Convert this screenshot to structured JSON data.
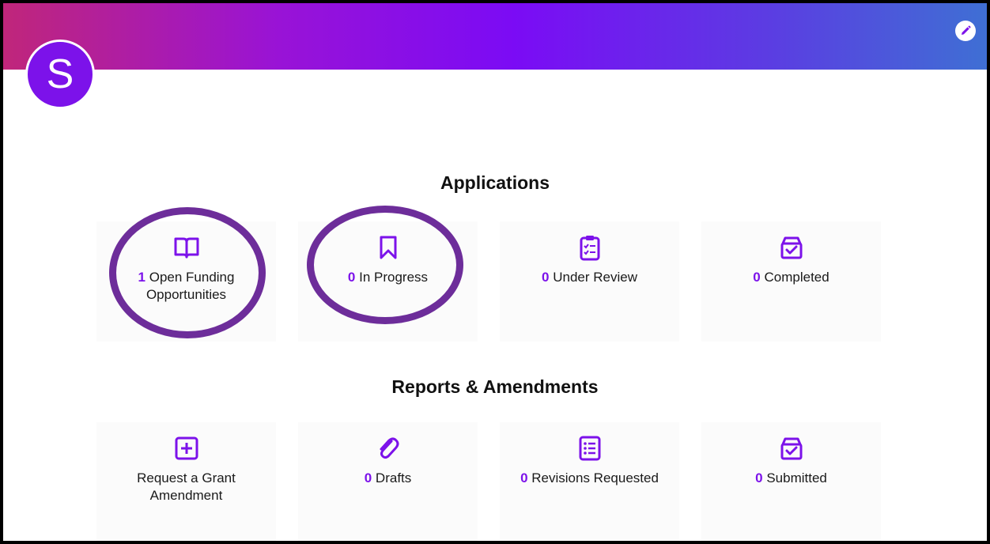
{
  "header": {
    "avatar_letter": "S",
    "edit_icon": "pencil-icon"
  },
  "applications": {
    "title": "Applications",
    "cards": [
      {
        "icon": "book-open-icon",
        "count": "1",
        "text": "Open Funding Opportunities"
      },
      {
        "icon": "bookmark-icon",
        "count": "0",
        "text": "In Progress"
      },
      {
        "icon": "clipboard-check-icon",
        "count": "0",
        "text": "Under Review"
      },
      {
        "icon": "archive-check-icon",
        "count": "0",
        "text": "Completed"
      }
    ]
  },
  "reports": {
    "title": "Reports & Amendments",
    "cards": [
      {
        "icon": "plus-square-icon",
        "count": "",
        "text": "Request a Grant Amendment"
      },
      {
        "icon": "paperclip-icon",
        "count": "0",
        "text": "Drafts"
      },
      {
        "icon": "list-icon",
        "count": "0",
        "text": "Revisions Requested"
      },
      {
        "icon": "archive-check-icon",
        "count": "0",
        "text": "Submitted"
      }
    ]
  },
  "colors": {
    "accent": "#7c12ea",
    "highlight_ring": "#6d2d9a"
  }
}
